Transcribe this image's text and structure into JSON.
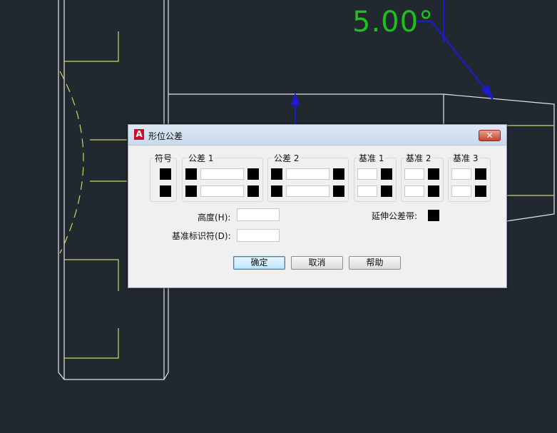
{
  "canvas": {
    "dimension_text": "5.00°",
    "colors": {
      "background": "#212830",
      "lines": "#ffffff",
      "hatch": "#c8d86a",
      "dimension": "#1fbf1f",
      "leader": "#1b1bd6"
    }
  },
  "dialog": {
    "title": "形位公差",
    "app_icon": "A",
    "close_icon": "close-icon",
    "groups": {
      "symbol": "符号",
      "tol1": "公差 1",
      "tol2": "公差 2",
      "datum1": "基准 1",
      "datum2": "基准 2",
      "datum3": "基准 3"
    },
    "fields": {
      "tol1_row1": "",
      "tol1_row2": "",
      "tol2_row1": "",
      "tol2_row2": "",
      "datum1_row1": "",
      "datum1_row2": "",
      "datum2_row1": "",
      "datum2_row2": "",
      "datum3_row1": "",
      "datum3_row2": ""
    },
    "height_label": "高度(H):",
    "height_value": "",
    "datum_id_label": "基准标识符(D):",
    "datum_id_value": "",
    "projected_zone_label": "延伸公差带:",
    "buttons": {
      "ok": "确定",
      "cancel": "取消",
      "help": "帮助"
    }
  }
}
